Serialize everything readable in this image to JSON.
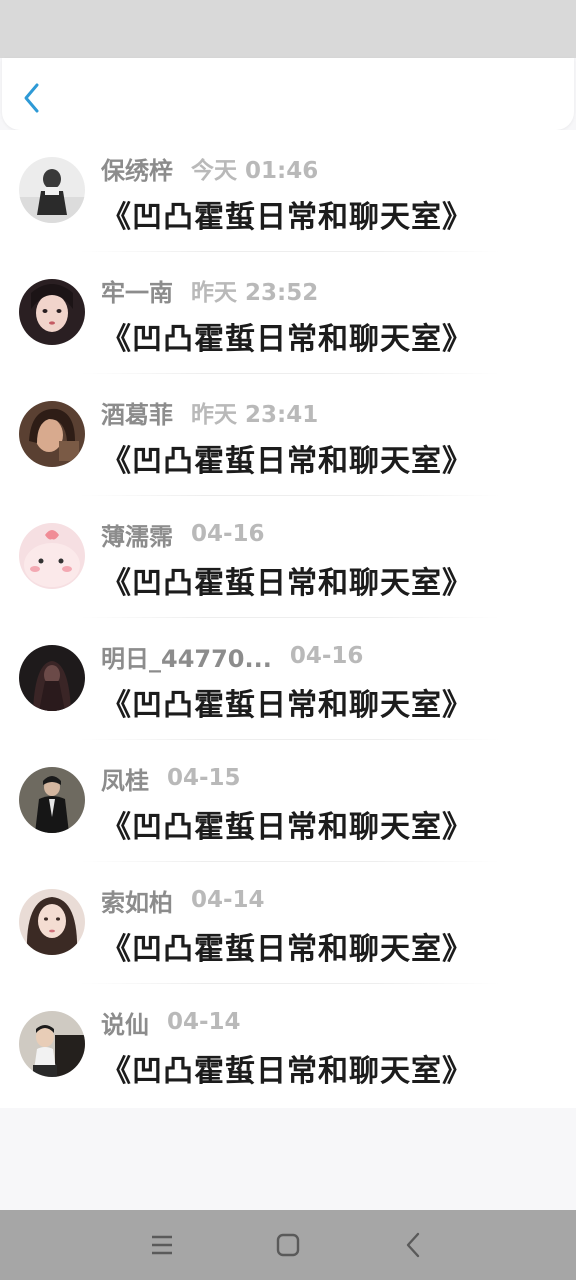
{
  "header": {
    "back_icon": "chevron-left-icon",
    "accent": "#2e9ad6"
  },
  "entries": [
    {
      "name": "保绣梓",
      "time": "今天 01:46",
      "title": "《凹凸霍蜇日常和聊天室》"
    },
    {
      "name": "牢一南",
      "time": "昨天 23:52",
      "title": "《凹凸霍蜇日常和聊天室》"
    },
    {
      "name": "酒葛菲",
      "time": "昨天 23:41",
      "title": "《凹凸霍蜇日常和聊天室》"
    },
    {
      "name": "薄濡霈",
      "time": "04-16",
      "title": "《凹凸霍蜇日常和聊天室》"
    },
    {
      "name": "明日_44770...",
      "time": "04-16",
      "title": "《凹凸霍蜇日常和聊天室》"
    },
    {
      "name": "凤桂",
      "time": "04-15",
      "title": "《凹凸霍蜇日常和聊天室》"
    },
    {
      "name": "索如柏",
      "time": "04-14",
      "title": "《凹凸霍蜇日常和聊天室》"
    },
    {
      "name": "说仙",
      "time": "04-14",
      "title": "《凹凸霍蜇日常和聊天室》"
    }
  ],
  "nav": {
    "menu_icon": "menu-icon",
    "home_icon": "home-square-icon",
    "back_icon": "back-chevron-icon"
  }
}
